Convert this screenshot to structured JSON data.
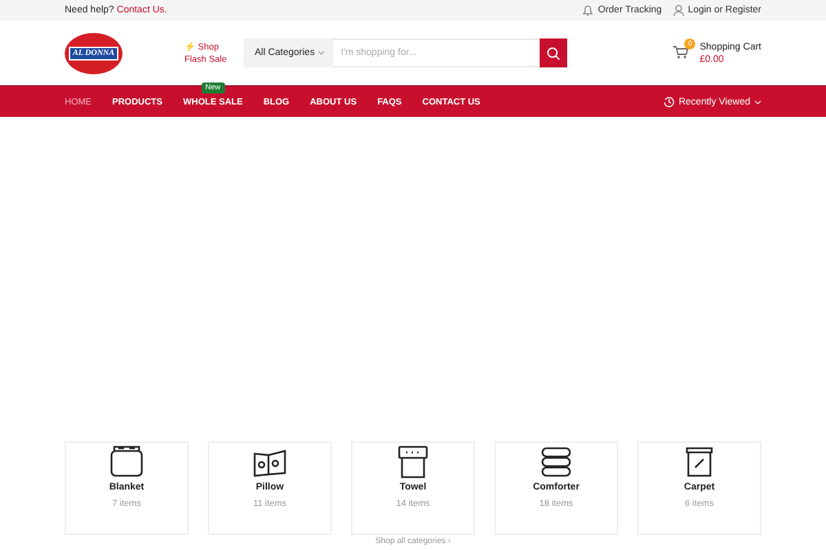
{
  "top_bar": {
    "help_text": "Need help?",
    "help_link": "Contact Us.",
    "links": [
      {
        "label": "Order Tracking",
        "kind": "bell"
      },
      {
        "label": "Login or Register",
        "kind": "user"
      }
    ]
  },
  "header": {
    "logo_text": "AL DONNA",
    "promo": [
      "⚡ Shop",
      "Flash Sale"
    ],
    "search": {
      "category": "All Categories",
      "placeholder": "I'm shopping for..."
    },
    "cart": {
      "count": "0",
      "label": "Shopping Cart",
      "total": "£0.00"
    }
  },
  "nav": {
    "items": [
      {
        "label": "HOME",
        "selected": true
      },
      {
        "label": "PRODUCTS",
        "selected": false
      },
      {
        "label": "WHOLE SALE",
        "selected": false,
        "badge": "New"
      },
      {
        "label": "BLOG",
        "selected": false
      },
      {
        "label": "ABOUT US",
        "selected": false
      },
      {
        "label": "FAQS",
        "selected": false
      },
      {
        "label": "CONTACT US",
        "selected": false
      }
    ],
    "recently_viewed": "Recently Viewed"
  },
  "categories": [
    {
      "name": "Blanket",
      "count": "7 items",
      "kind": "blanket"
    },
    {
      "name": "Pillow",
      "count": "11 items",
      "kind": "pillow"
    },
    {
      "name": "Towel",
      "count": "14 items",
      "kind": "towel"
    },
    {
      "name": "Comforter",
      "count": "18 items",
      "kind": "comforter"
    },
    {
      "name": "Carpet",
      "count": "6 items",
      "kind": "carpet"
    }
  ],
  "shop_all": "Shop all categories ›"
}
